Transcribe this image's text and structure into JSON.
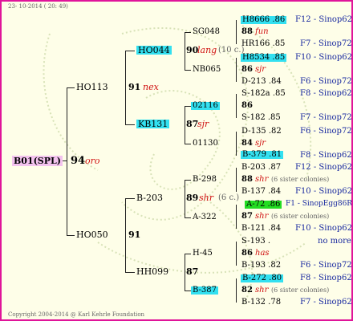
{
  "header_date": "23- 10-2014 ( 20: 49)",
  "footer": "Copyright 2004-2014 @ Karl Kehrle Foundation",
  "root": {
    "code": "B01(SPL)",
    "num": "94",
    "breed": "oro"
  },
  "gen1": [
    {
      "code": "HO113",
      "num": "91",
      "breed": "nex"
    },
    {
      "code": "HO050",
      "num": "91",
      "breed": ""
    }
  ],
  "gen2": [
    {
      "code": "HO044",
      "num": "90",
      "breed": "lang",
      "extra": "(10 c.)"
    },
    {
      "code": "KB131",
      "num": "87",
      "breed": "sjr",
      "extra": ""
    },
    {
      "code": "B-203",
      "num": "89",
      "breed": "shr",
      "extra": "(6 c.)"
    },
    {
      "code": "HH099",
      "num": "87",
      "breed": "",
      "extra": ""
    }
  ],
  "gen3": [
    "SG048",
    "NB065",
    "02116",
    "01130",
    "B-298",
    "A-322",
    "H-45",
    "B-387"
  ],
  "gen4": [
    {
      "top": "H8666 .86",
      "top_right": "F12 - Sinop62R",
      "num": "88",
      "breed": "fun",
      "note": "",
      "bot": "HR166 .85",
      "bot_right": "F7 - Sinop72R"
    },
    {
      "top": "H8534 .85",
      "top_right": "F10 - Sinop62R",
      "num": "86",
      "breed": "sjr",
      "note": "",
      "bot": "D-213 .84",
      "bot_right": "F6 - Sinop72R"
    },
    {
      "top": "S-182a .85",
      "top_right": "F8 - Sinop62R",
      "num": "86",
      "breed": "",
      "note": "",
      "bot": "S-182 .85",
      "bot_right": "F7 - Sinop72R"
    },
    {
      "top": "D-135 .82",
      "top_right": "F6 - Sinop72R",
      "num": "84",
      "breed": "sjr",
      "note": "",
      "bot": "B-379 .81",
      "bot_right": "F8 - Sinop62R"
    },
    {
      "top": "B-203 .87",
      "top_right": "F12 - Sinop62R",
      "num": "88",
      "breed": "shr",
      "note": "(6 sister colonies)",
      "bot": "B-137 .84",
      "bot_right": "F10 - Sinop62R"
    },
    {
      "top": "A-72 .86",
      "top_right": "F1 - SinopEgg86R",
      "num": "87",
      "breed": "shr",
      "note": "(6 sister colonies)",
      "bot": "B-121 .84",
      "bot_right": "F10 - Sinop62R"
    },
    {
      "top": "S-193 .",
      "top_right": "no more",
      "num": "86",
      "breed": "has",
      "note": "",
      "bot": "B-193 .82",
      "bot_right": "F6 - Sinop72R"
    },
    {
      "top": "B-272 .80",
      "top_right": "F8 - Sinop62R",
      "num": "82",
      "breed": "shr",
      "note": "(6 sister colonies)",
      "bot": "B-132 .78",
      "bot_right": "F7 - Sinop62R"
    }
  ]
}
